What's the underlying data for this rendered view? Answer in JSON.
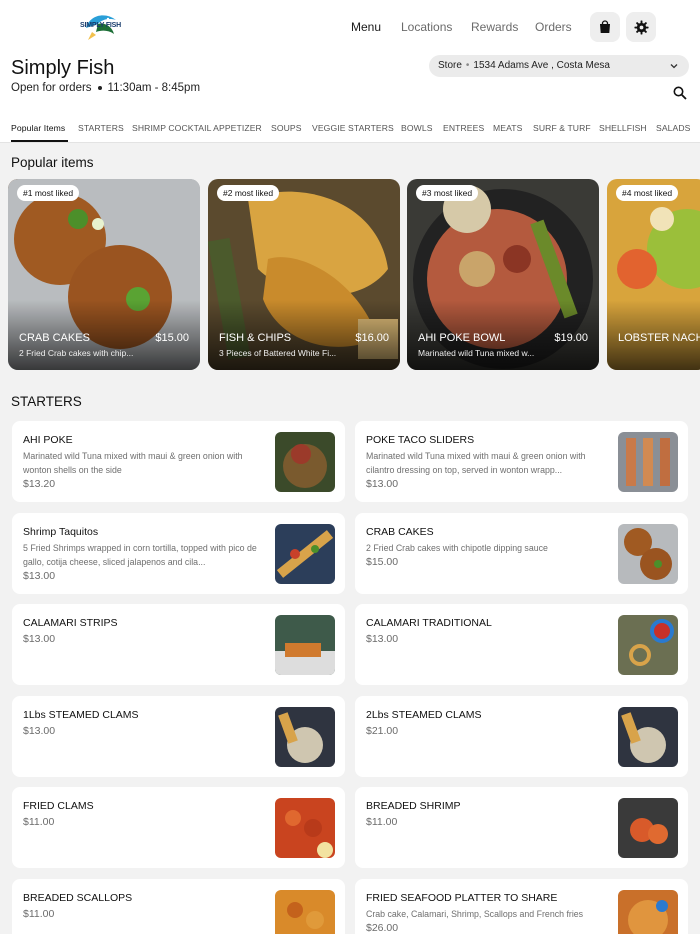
{
  "header": {
    "logo_text": "SIMPLY FISH",
    "nav": [
      "Menu",
      "Locations",
      "Rewards",
      "Orders"
    ],
    "bag_icon": "shopping-bag-icon",
    "settings_icon": "gear-icon"
  },
  "store": {
    "title": "Simply Fish",
    "status": "Open for orders",
    "hours": "11:30am - 8:45pm",
    "selector_label": "Store",
    "selector_value": "1534 Adams Ave , Costa Mesa"
  },
  "tabs": [
    "Popular Items",
    "STARTERS",
    "SHRIMP COCKTAIL APPETIZER",
    "SOUPS",
    "VEGGIE STARTERS",
    "BOWLS",
    "ENTREES",
    "MEATS",
    "SURF & TURF",
    "SHELLFISH",
    "SALADS"
  ],
  "popular": {
    "heading": "Popular items",
    "items": [
      {
        "badge": "#1 most liked",
        "name": "CRAB CAKES",
        "price": "$15.00",
        "desc": "2 Fried Crab cakes with chip..."
      },
      {
        "badge": "#2 most liked",
        "name": "FISH & CHIPS",
        "price": "$16.00",
        "desc": "3 Pieces of Battered White Fi..."
      },
      {
        "badge": "#3 most liked",
        "name": "AHI POKE BOWL",
        "price": "$19.00",
        "desc": "Marinated wild Tuna mixed w..."
      },
      {
        "badge": "#4 most liked",
        "name": "LOBSTER NACH",
        "price": "",
        "desc": ""
      }
    ]
  },
  "starters": {
    "heading": "STARTERS",
    "items": [
      {
        "name": "AHI POKE",
        "desc": "Marinated wild Tuna mixed with maui & green onion with wonton shells on the side",
        "price": "$13.20"
      },
      {
        "name": "POKE TACO SLIDERS",
        "desc": "Marinated wild Tuna mixed with maui & green onion with cilantro dressing on top, served in wonton wrapp...",
        "price": "$13.00"
      },
      {
        "name": "Shrimp Taquitos",
        "desc": "5 Fried Shrimps wrapped in corn tortilla, topped with pico de gallo, cotija cheese, sliced jalapenos and cila...",
        "price": "$13.00"
      },
      {
        "name": "CRAB CAKES",
        "desc": "2 Fried Crab cakes with chipotle dipping sauce",
        "price": "$15.00"
      },
      {
        "name": "CALAMARI STRIPS",
        "desc": "",
        "price": "$13.00"
      },
      {
        "name": "CALAMARI TRADITIONAL",
        "desc": "",
        "price": "$13.00"
      },
      {
        "name": "1Lbs STEAMED CLAMS",
        "desc": "",
        "price": "$13.00"
      },
      {
        "name": "2Lbs STEAMED CLAMS",
        "desc": "",
        "price": "$21.00"
      },
      {
        "name": "FRIED CLAMS",
        "desc": "",
        "price": "$11.00"
      },
      {
        "name": "BREADED SHRIMP",
        "desc": "",
        "price": "$11.00"
      },
      {
        "name": "BREADED SCALLOPS",
        "desc": "",
        "price": "$11.00"
      },
      {
        "name": "FRIED SEAFOOD PLATTER TO SHARE",
        "desc": "Crab cake, Calamari, Shrimp, Scallops and French fries",
        "price": "$26.00"
      }
    ]
  }
}
